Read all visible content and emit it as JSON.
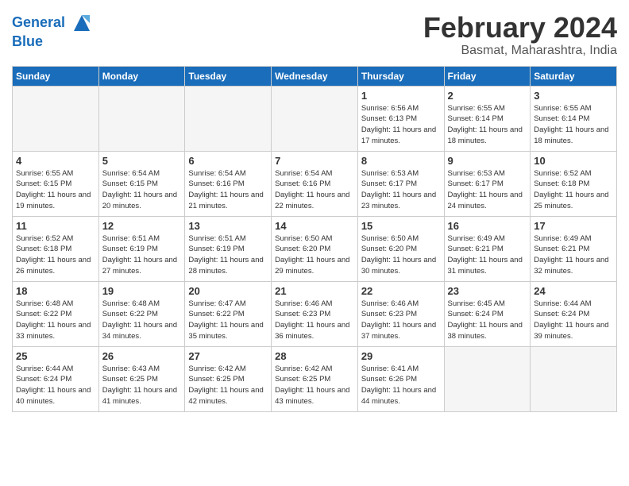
{
  "header": {
    "logo_line1": "General",
    "logo_line2": "Blue",
    "month_title": "February 2024",
    "location": "Basmat, Maharashtra, India"
  },
  "weekdays": [
    "Sunday",
    "Monday",
    "Tuesday",
    "Wednesday",
    "Thursday",
    "Friday",
    "Saturday"
  ],
  "weeks": [
    [
      {
        "day": "",
        "info": ""
      },
      {
        "day": "",
        "info": ""
      },
      {
        "day": "",
        "info": ""
      },
      {
        "day": "",
        "info": ""
      },
      {
        "day": "1",
        "info": "Sunrise: 6:56 AM\nSunset: 6:13 PM\nDaylight: 11 hours\nand 17 minutes."
      },
      {
        "day": "2",
        "info": "Sunrise: 6:55 AM\nSunset: 6:14 PM\nDaylight: 11 hours\nand 18 minutes."
      },
      {
        "day": "3",
        "info": "Sunrise: 6:55 AM\nSunset: 6:14 PM\nDaylight: 11 hours\nand 18 minutes."
      }
    ],
    [
      {
        "day": "4",
        "info": "Sunrise: 6:55 AM\nSunset: 6:15 PM\nDaylight: 11 hours\nand 19 minutes."
      },
      {
        "day": "5",
        "info": "Sunrise: 6:54 AM\nSunset: 6:15 PM\nDaylight: 11 hours\nand 20 minutes."
      },
      {
        "day": "6",
        "info": "Sunrise: 6:54 AM\nSunset: 6:16 PM\nDaylight: 11 hours\nand 21 minutes."
      },
      {
        "day": "7",
        "info": "Sunrise: 6:54 AM\nSunset: 6:16 PM\nDaylight: 11 hours\nand 22 minutes."
      },
      {
        "day": "8",
        "info": "Sunrise: 6:53 AM\nSunset: 6:17 PM\nDaylight: 11 hours\nand 23 minutes."
      },
      {
        "day": "9",
        "info": "Sunrise: 6:53 AM\nSunset: 6:17 PM\nDaylight: 11 hours\nand 24 minutes."
      },
      {
        "day": "10",
        "info": "Sunrise: 6:52 AM\nSunset: 6:18 PM\nDaylight: 11 hours\nand 25 minutes."
      }
    ],
    [
      {
        "day": "11",
        "info": "Sunrise: 6:52 AM\nSunset: 6:18 PM\nDaylight: 11 hours\nand 26 minutes."
      },
      {
        "day": "12",
        "info": "Sunrise: 6:51 AM\nSunset: 6:19 PM\nDaylight: 11 hours\nand 27 minutes."
      },
      {
        "day": "13",
        "info": "Sunrise: 6:51 AM\nSunset: 6:19 PM\nDaylight: 11 hours\nand 28 minutes."
      },
      {
        "day": "14",
        "info": "Sunrise: 6:50 AM\nSunset: 6:20 PM\nDaylight: 11 hours\nand 29 minutes."
      },
      {
        "day": "15",
        "info": "Sunrise: 6:50 AM\nSunset: 6:20 PM\nDaylight: 11 hours\nand 30 minutes."
      },
      {
        "day": "16",
        "info": "Sunrise: 6:49 AM\nSunset: 6:21 PM\nDaylight: 11 hours\nand 31 minutes."
      },
      {
        "day": "17",
        "info": "Sunrise: 6:49 AM\nSunset: 6:21 PM\nDaylight: 11 hours\nand 32 minutes."
      }
    ],
    [
      {
        "day": "18",
        "info": "Sunrise: 6:48 AM\nSunset: 6:22 PM\nDaylight: 11 hours\nand 33 minutes."
      },
      {
        "day": "19",
        "info": "Sunrise: 6:48 AM\nSunset: 6:22 PM\nDaylight: 11 hours\nand 34 minutes."
      },
      {
        "day": "20",
        "info": "Sunrise: 6:47 AM\nSunset: 6:22 PM\nDaylight: 11 hours\nand 35 minutes."
      },
      {
        "day": "21",
        "info": "Sunrise: 6:46 AM\nSunset: 6:23 PM\nDaylight: 11 hours\nand 36 minutes."
      },
      {
        "day": "22",
        "info": "Sunrise: 6:46 AM\nSunset: 6:23 PM\nDaylight: 11 hours\nand 37 minutes."
      },
      {
        "day": "23",
        "info": "Sunrise: 6:45 AM\nSunset: 6:24 PM\nDaylight: 11 hours\nand 38 minutes."
      },
      {
        "day": "24",
        "info": "Sunrise: 6:44 AM\nSunset: 6:24 PM\nDaylight: 11 hours\nand 39 minutes."
      }
    ],
    [
      {
        "day": "25",
        "info": "Sunrise: 6:44 AM\nSunset: 6:24 PM\nDaylight: 11 hours\nand 40 minutes."
      },
      {
        "day": "26",
        "info": "Sunrise: 6:43 AM\nSunset: 6:25 PM\nDaylight: 11 hours\nand 41 minutes."
      },
      {
        "day": "27",
        "info": "Sunrise: 6:42 AM\nSunset: 6:25 PM\nDaylight: 11 hours\nand 42 minutes."
      },
      {
        "day": "28",
        "info": "Sunrise: 6:42 AM\nSunset: 6:25 PM\nDaylight: 11 hours\nand 43 minutes."
      },
      {
        "day": "29",
        "info": "Sunrise: 6:41 AM\nSunset: 6:26 PM\nDaylight: 11 hours\nand 44 minutes."
      },
      {
        "day": "",
        "info": ""
      },
      {
        "day": "",
        "info": ""
      }
    ]
  ]
}
